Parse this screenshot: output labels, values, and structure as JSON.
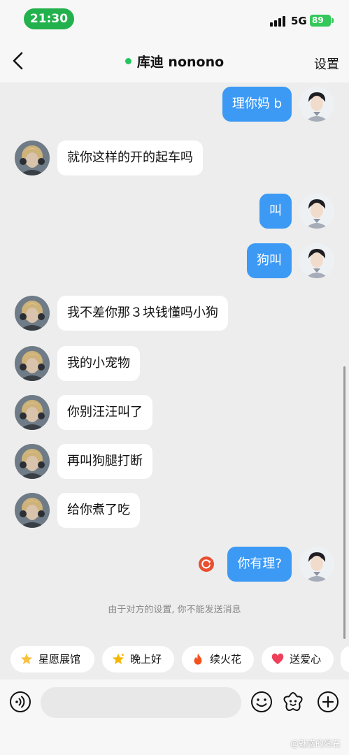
{
  "status": {
    "time": "21:30",
    "network": "5G",
    "battery": "89"
  },
  "header": {
    "title": "库迪 nonono",
    "settings_label": "设置"
  },
  "messages": [
    {
      "dir": "out",
      "text": "理你妈 b"
    },
    {
      "dir": "in",
      "text": "就你这样的开的起车吗"
    },
    {
      "dir": "out",
      "text": "叫"
    },
    {
      "dir": "out",
      "text": "狗叫"
    },
    {
      "dir": "in",
      "text": "我不差你那３块钱懂吗小狗"
    },
    {
      "dir": "in",
      "text": "我的小宠物"
    },
    {
      "dir": "in",
      "text": "你别汪汪叫了"
    },
    {
      "dir": "in",
      "text": "再叫狗腿打断"
    },
    {
      "dir": "in",
      "text": "给你煮了吃"
    },
    {
      "dir": "out",
      "text": "你有理?",
      "failed": true
    }
  ],
  "notice": "由于对方的设置, 你不能发送消息",
  "quick_chips": [
    {
      "label": "星愿展馆",
      "icon": "star-icon"
    },
    {
      "label": "晚上好",
      "icon": "sparkle-star-icon"
    },
    {
      "label": "续火花",
      "icon": "flame-icon"
    },
    {
      "label": "送爱心",
      "icon": "heart-icon"
    }
  ],
  "watermark": "@魅惑的残石",
  "colors": {
    "accent_green": "#22b14c",
    "sent_bubble": "#3c9af5",
    "retry_red": "#ea4e2f"
  }
}
